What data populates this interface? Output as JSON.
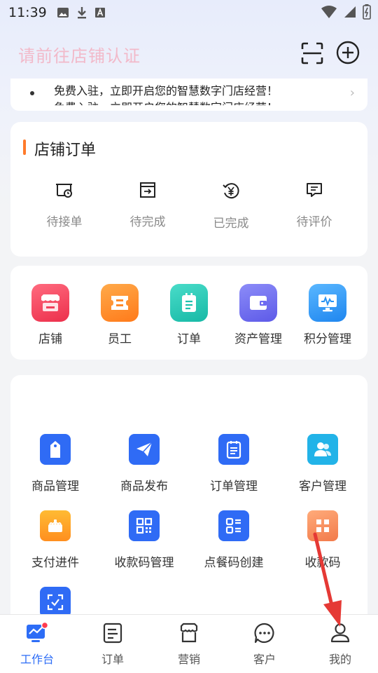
{
  "status_bar": {
    "time": "11:39"
  },
  "header": {
    "title": "请前往店铺认证"
  },
  "notice": {
    "line1": "免费入驻，立即开启您的智慧数字门店经营！",
    "line2": "免费入驻，立即开启您的智慧数字门店经营！"
  },
  "orders": {
    "title": "店铺订单",
    "items": [
      {
        "label": "待接单",
        "icon": "pending-order-icon"
      },
      {
        "label": "待完成",
        "icon": "to-complete-icon"
      },
      {
        "label": "已完成",
        "icon": "completed-yen-icon"
      },
      {
        "label": "待评价",
        "icon": "review-icon"
      }
    ]
  },
  "quick": {
    "items": [
      {
        "label": "店铺",
        "icon": "store-icon",
        "color": "#f1405a"
      },
      {
        "label": "员工",
        "icon": "staff-icon",
        "color": "#ff8a2a"
      },
      {
        "label": "订单",
        "icon": "order-icon",
        "color": "#23c7b4"
      },
      {
        "label": "资产管理",
        "icon": "wallet-icon",
        "color": "#6e6cf3"
      },
      {
        "label": "积分管理",
        "icon": "points-icon",
        "color": "#2f9bf5"
      }
    ]
  },
  "tools": {
    "items": [
      {
        "label": "商品管理",
        "icon": "tag-icon"
      },
      {
        "label": "商品发布",
        "icon": "send-icon"
      },
      {
        "label": "订单管理",
        "icon": "order-list-icon"
      },
      {
        "label": "客户管理",
        "icon": "customers-icon"
      },
      {
        "label": "支付进件",
        "icon": "payment-icon"
      },
      {
        "label": "收款码管理",
        "icon": "qr-code-icon"
      },
      {
        "label": "点餐码创建",
        "icon": "menu-qr-icon"
      },
      {
        "label": "收款码",
        "icon": "collect-code-icon"
      }
    ]
  },
  "tabbar": {
    "items": [
      {
        "label": "工作台",
        "icon": "dashboard-icon",
        "active": true
      },
      {
        "label": "订单",
        "icon": "order-tab-icon"
      },
      {
        "label": "营销",
        "icon": "marketing-icon"
      },
      {
        "label": "客户",
        "icon": "chat-icon"
      },
      {
        "label": "我的",
        "icon": "profile-icon"
      }
    ]
  },
  "colors": {
    "accent": "#2d6df6",
    "header_title": "#f2b9c9",
    "section_bar": "#ff7a2b",
    "annotation_arrow": "#e53935"
  }
}
